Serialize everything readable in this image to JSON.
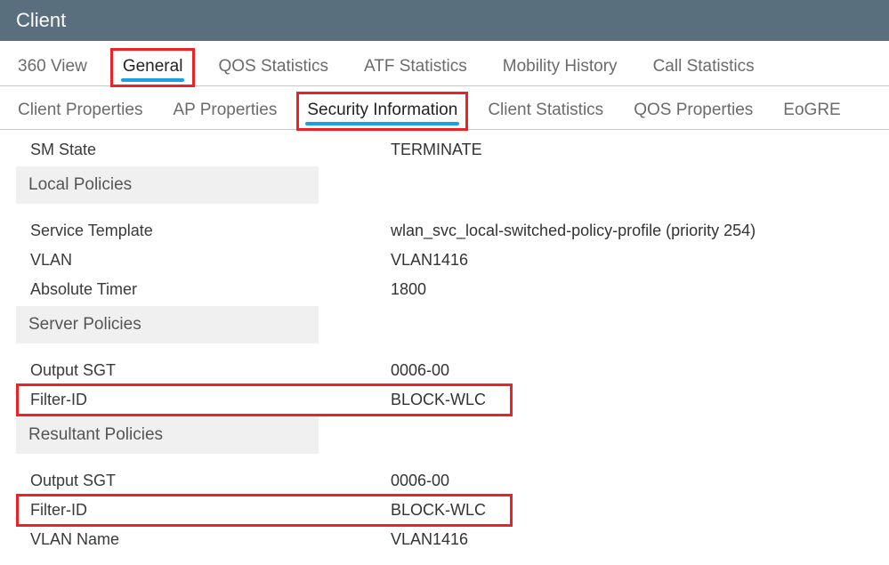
{
  "header": {
    "title": "Client"
  },
  "tabs": {
    "items": [
      {
        "label": "360 View"
      },
      {
        "label": "General"
      },
      {
        "label": "QOS Statistics"
      },
      {
        "label": "ATF Statistics"
      },
      {
        "label": "Mobility History"
      },
      {
        "label": "Call Statistics"
      }
    ]
  },
  "subtabs": {
    "items": [
      {
        "label": "Client Properties"
      },
      {
        "label": "AP Properties"
      },
      {
        "label": "Security Information"
      },
      {
        "label": "Client Statistics"
      },
      {
        "label": "QOS Properties"
      },
      {
        "label": "EoGRE"
      }
    ]
  },
  "security": {
    "sm_state": {
      "label": "SM State",
      "value": "TERMINATE"
    },
    "local_policies": {
      "header": "Local Policies",
      "service_template": {
        "label": "Service Template",
        "value": "wlan_svc_local-switched-policy-profile (priority 254)"
      },
      "vlan": {
        "label": "VLAN",
        "value": "VLAN1416"
      },
      "absolute_timer": {
        "label": "Absolute Timer",
        "value": "1800"
      }
    },
    "server_policies": {
      "header": "Server Policies",
      "output_sgt": {
        "label": "Output SGT",
        "value": "0006-00"
      },
      "filter_id": {
        "label": "Filter-ID",
        "value": "BLOCK-WLC"
      }
    },
    "resultant_policies": {
      "header": "Resultant Policies",
      "output_sgt": {
        "label": "Output SGT",
        "value": "0006-00"
      },
      "filter_id": {
        "label": "Filter-ID",
        "value": "BLOCK-WLC"
      },
      "vlan_name": {
        "label": "VLAN Name",
        "value": "VLAN1416"
      }
    }
  }
}
